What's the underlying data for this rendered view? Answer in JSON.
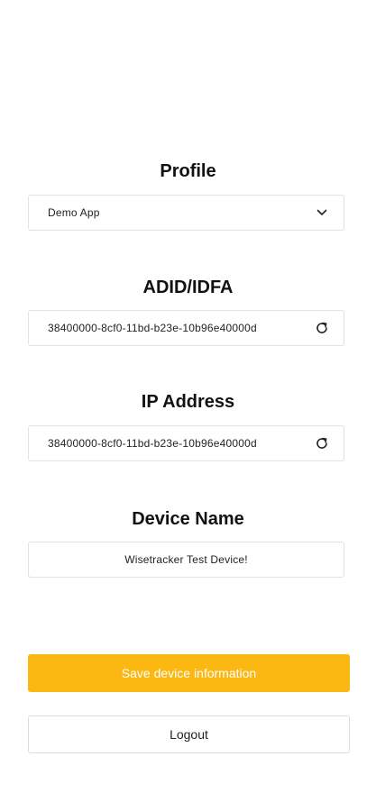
{
  "profile": {
    "title": "Profile",
    "selected": "Demo App"
  },
  "adid": {
    "title": "ADID/IDFA",
    "value": "38400000-8cf0-11bd-b23e-10b96e40000d"
  },
  "ip": {
    "title": "IP Address",
    "value": "38400000-8cf0-11bd-b23e-10b96e40000d"
  },
  "device": {
    "title": "Device Name",
    "value": "Wisetracker Test Device!"
  },
  "actions": {
    "save_label": "Save device information",
    "logout_label": "Logout"
  },
  "colors": {
    "accent": "#fbb813",
    "border": "#e2e2e2"
  },
  "icons": {
    "dropdown": "chevron-down-icon",
    "refresh": "refresh-icon"
  }
}
